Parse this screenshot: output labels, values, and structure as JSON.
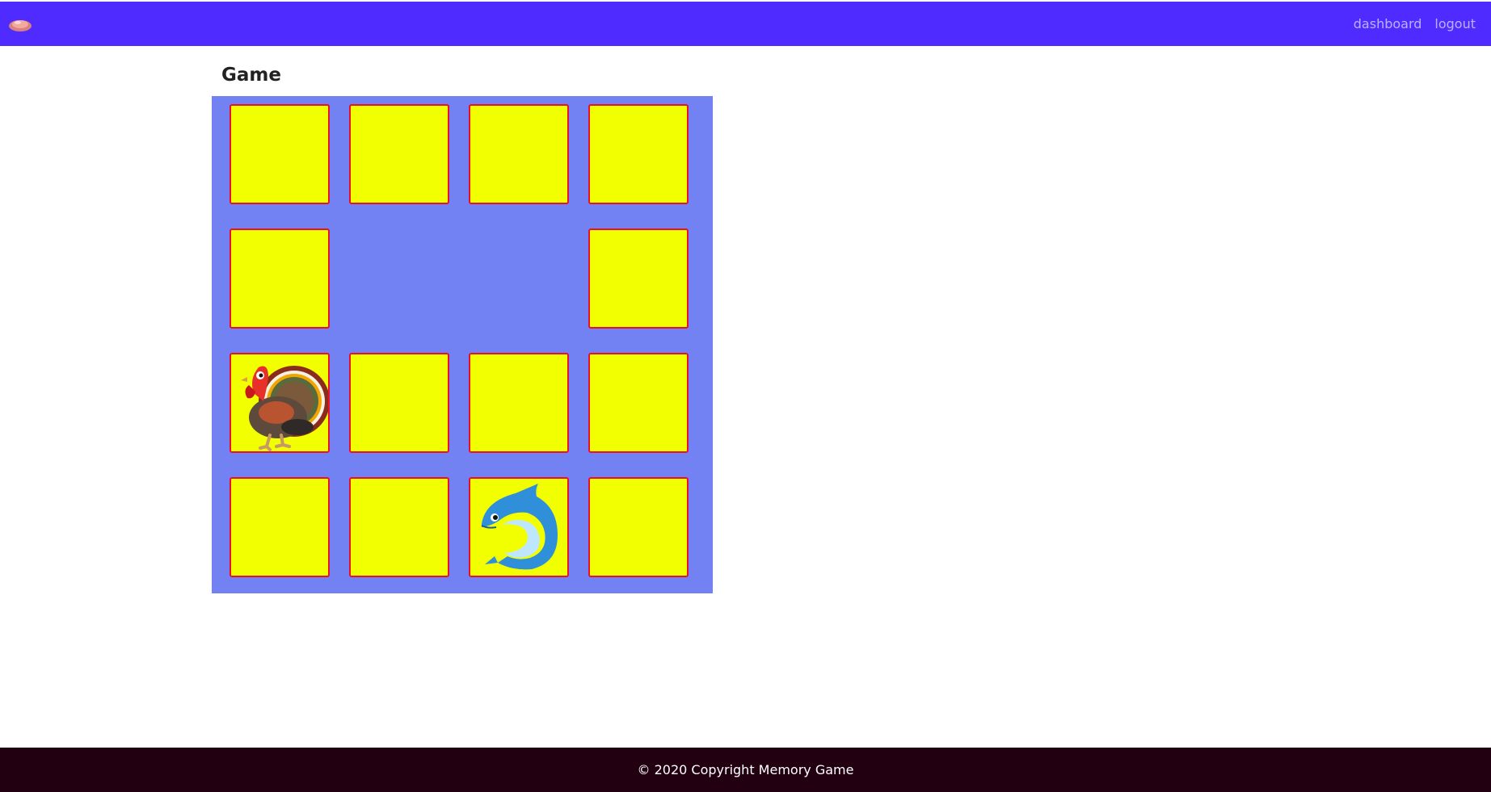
{
  "navbar": {
    "brand_icon": "cloud-logo-icon",
    "links": [
      {
        "label": "dashboard"
      },
      {
        "label": "logout"
      }
    ],
    "color": "#4f2bff",
    "link_color": "#b9b3ff"
  },
  "game": {
    "title": "Game",
    "board_color": "#7282f2",
    "card_color": "#f2ff00",
    "card_border_color": "#e8102a",
    "rows": 4,
    "cols": 4,
    "cards": [
      {
        "state": "hidden"
      },
      {
        "state": "hidden"
      },
      {
        "state": "hidden"
      },
      {
        "state": "hidden"
      },
      {
        "state": "hidden"
      },
      {
        "state": "matched"
      },
      {
        "state": "matched"
      },
      {
        "state": "hidden"
      },
      {
        "state": "revealed",
        "icon": "turkey-icon"
      },
      {
        "state": "hidden"
      },
      {
        "state": "hidden"
      },
      {
        "state": "hidden"
      },
      {
        "state": "hidden"
      },
      {
        "state": "hidden"
      },
      {
        "state": "revealed",
        "icon": "dolphin-icon"
      },
      {
        "state": "hidden"
      }
    ]
  },
  "footer": {
    "text": "© 2020 Copyright Memory Game",
    "color": "#220012"
  }
}
